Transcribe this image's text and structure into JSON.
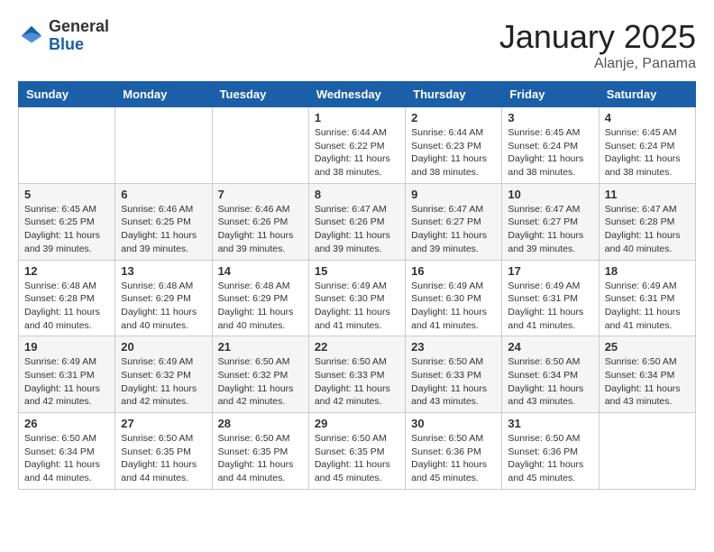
{
  "header": {
    "logo_general": "General",
    "logo_blue": "Blue",
    "month": "January 2025",
    "location": "Alanje, Panama"
  },
  "weekdays": [
    "Sunday",
    "Monday",
    "Tuesday",
    "Wednesday",
    "Thursday",
    "Friday",
    "Saturday"
  ],
  "weeks": [
    [
      {
        "day": "",
        "info": ""
      },
      {
        "day": "",
        "info": ""
      },
      {
        "day": "",
        "info": ""
      },
      {
        "day": "1",
        "info": "Sunrise: 6:44 AM\nSunset: 6:22 PM\nDaylight: 11 hours\nand 38 minutes."
      },
      {
        "day": "2",
        "info": "Sunrise: 6:44 AM\nSunset: 6:23 PM\nDaylight: 11 hours\nand 38 minutes."
      },
      {
        "day": "3",
        "info": "Sunrise: 6:45 AM\nSunset: 6:24 PM\nDaylight: 11 hours\nand 38 minutes."
      },
      {
        "day": "4",
        "info": "Sunrise: 6:45 AM\nSunset: 6:24 PM\nDaylight: 11 hours\nand 38 minutes."
      }
    ],
    [
      {
        "day": "5",
        "info": "Sunrise: 6:45 AM\nSunset: 6:25 PM\nDaylight: 11 hours\nand 39 minutes."
      },
      {
        "day": "6",
        "info": "Sunrise: 6:46 AM\nSunset: 6:25 PM\nDaylight: 11 hours\nand 39 minutes."
      },
      {
        "day": "7",
        "info": "Sunrise: 6:46 AM\nSunset: 6:26 PM\nDaylight: 11 hours\nand 39 minutes."
      },
      {
        "day": "8",
        "info": "Sunrise: 6:47 AM\nSunset: 6:26 PM\nDaylight: 11 hours\nand 39 minutes."
      },
      {
        "day": "9",
        "info": "Sunrise: 6:47 AM\nSunset: 6:27 PM\nDaylight: 11 hours\nand 39 minutes."
      },
      {
        "day": "10",
        "info": "Sunrise: 6:47 AM\nSunset: 6:27 PM\nDaylight: 11 hours\nand 39 minutes."
      },
      {
        "day": "11",
        "info": "Sunrise: 6:47 AM\nSunset: 6:28 PM\nDaylight: 11 hours\nand 40 minutes."
      }
    ],
    [
      {
        "day": "12",
        "info": "Sunrise: 6:48 AM\nSunset: 6:28 PM\nDaylight: 11 hours\nand 40 minutes."
      },
      {
        "day": "13",
        "info": "Sunrise: 6:48 AM\nSunset: 6:29 PM\nDaylight: 11 hours\nand 40 minutes."
      },
      {
        "day": "14",
        "info": "Sunrise: 6:48 AM\nSunset: 6:29 PM\nDaylight: 11 hours\nand 40 minutes."
      },
      {
        "day": "15",
        "info": "Sunrise: 6:49 AM\nSunset: 6:30 PM\nDaylight: 11 hours\nand 41 minutes."
      },
      {
        "day": "16",
        "info": "Sunrise: 6:49 AM\nSunset: 6:30 PM\nDaylight: 11 hours\nand 41 minutes."
      },
      {
        "day": "17",
        "info": "Sunrise: 6:49 AM\nSunset: 6:31 PM\nDaylight: 11 hours\nand 41 minutes."
      },
      {
        "day": "18",
        "info": "Sunrise: 6:49 AM\nSunset: 6:31 PM\nDaylight: 11 hours\nand 41 minutes."
      }
    ],
    [
      {
        "day": "19",
        "info": "Sunrise: 6:49 AM\nSunset: 6:31 PM\nDaylight: 11 hours\nand 42 minutes."
      },
      {
        "day": "20",
        "info": "Sunrise: 6:49 AM\nSunset: 6:32 PM\nDaylight: 11 hours\nand 42 minutes."
      },
      {
        "day": "21",
        "info": "Sunrise: 6:50 AM\nSunset: 6:32 PM\nDaylight: 11 hours\nand 42 minutes."
      },
      {
        "day": "22",
        "info": "Sunrise: 6:50 AM\nSunset: 6:33 PM\nDaylight: 11 hours\nand 42 minutes."
      },
      {
        "day": "23",
        "info": "Sunrise: 6:50 AM\nSunset: 6:33 PM\nDaylight: 11 hours\nand 43 minutes."
      },
      {
        "day": "24",
        "info": "Sunrise: 6:50 AM\nSunset: 6:34 PM\nDaylight: 11 hours\nand 43 minutes."
      },
      {
        "day": "25",
        "info": "Sunrise: 6:50 AM\nSunset: 6:34 PM\nDaylight: 11 hours\nand 43 minutes."
      }
    ],
    [
      {
        "day": "26",
        "info": "Sunrise: 6:50 AM\nSunset: 6:34 PM\nDaylight: 11 hours\nand 44 minutes."
      },
      {
        "day": "27",
        "info": "Sunrise: 6:50 AM\nSunset: 6:35 PM\nDaylight: 11 hours\nand 44 minutes."
      },
      {
        "day": "28",
        "info": "Sunrise: 6:50 AM\nSunset: 6:35 PM\nDaylight: 11 hours\nand 44 minutes."
      },
      {
        "day": "29",
        "info": "Sunrise: 6:50 AM\nSunset: 6:35 PM\nDaylight: 11 hours\nand 45 minutes."
      },
      {
        "day": "30",
        "info": "Sunrise: 6:50 AM\nSunset: 6:36 PM\nDaylight: 11 hours\nand 45 minutes."
      },
      {
        "day": "31",
        "info": "Sunrise: 6:50 AM\nSunset: 6:36 PM\nDaylight: 11 hours\nand 45 minutes."
      },
      {
        "day": "",
        "info": ""
      }
    ]
  ]
}
